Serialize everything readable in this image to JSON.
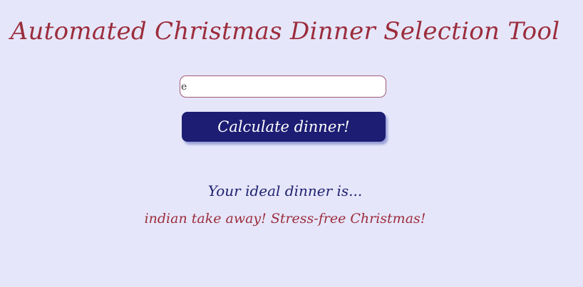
{
  "header": {
    "title": "Automated Christmas Dinner Selection Tool"
  },
  "form": {
    "input_value": "e",
    "button_label": "Calculate dinner!"
  },
  "result": {
    "heading": "Your ideal dinner is...",
    "text": "indian take away! Stress-free Christmas!"
  },
  "colors": {
    "background": "#e6e6fa",
    "title": "#9b2d3c",
    "button": "#1c1d73",
    "heading": "#1f2270",
    "result": "#9b2d3c"
  }
}
